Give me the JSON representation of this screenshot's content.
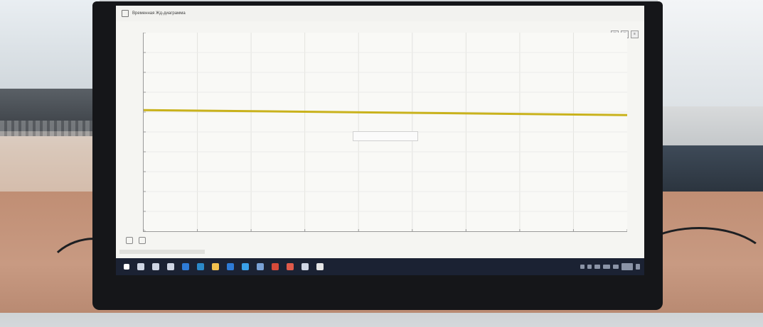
{
  "window": {
    "title": "Временная Жд-диаграмма"
  },
  "chart": {
    "caption": "",
    "center_label": "",
    "ylabel": "",
    "xlabel": ""
  },
  "chart_data": {
    "type": "line",
    "x": [
      0,
      100
    ],
    "series": [
      {
        "values": [
          6.1,
          5.85
        ],
        "color": "#c9b21c"
      }
    ],
    "ylim": [
      0,
      10
    ],
    "grid": true
  },
  "taskbar": {
    "icons": [
      "start-icon",
      "search-icon",
      "cortana-icon",
      "task-view-icon",
      "edge-icon",
      "explorer-icon",
      "store-icon",
      "mail-icon",
      "app-icon",
      "app-icon",
      "app-icon",
      "app-icon",
      "app-icon",
      "app-icon"
    ],
    "colors": [
      "#ffffff",
      "#cfd6e4",
      "#cfd6e4",
      "#cfd6e4",
      "#2e7bd6",
      "#2b89c9",
      "#f2c14e",
      "#2e7bd6",
      "#3aa0e8",
      "#7aa2d6",
      "#d64a3a",
      "#e05a4a",
      "#cfd6e4",
      "#e6e6e6"
    ]
  }
}
